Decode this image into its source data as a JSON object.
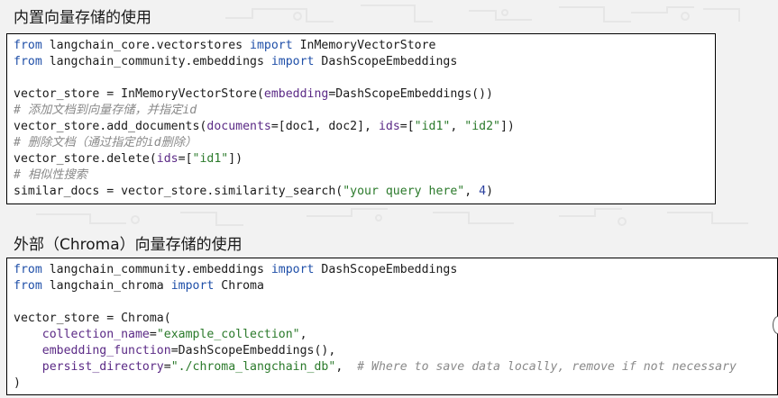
{
  "colors": {
    "keyword": "#1f4fa8",
    "parameter": "#5b2a86",
    "string": "#2b7a2b",
    "number": "#2a3f9e",
    "comment": "#8a8a8a",
    "text": "#1a1a1a"
  },
  "section1": {
    "title": "内置向量存储的使用",
    "code": {
      "l1": {
        "kw1": "from",
        "mod": " langchain_core.vectorstores ",
        "kw2": "import",
        "name": " InMemoryVectorStore"
      },
      "l2": {
        "kw1": "from",
        "mod": " langchain_community.embeddings ",
        "kw2": "import",
        "name": " DashScopeEmbeddings"
      },
      "l4": {
        "a": "vector_store = InMemoryVectorStore(",
        "p": "embedding",
        "b": "=DashScopeEmbeddings())"
      },
      "l5": {
        "comment": "# 添加文档到向量存储，并指定id"
      },
      "l6": {
        "a": "vector_store.add_documents(",
        "p1": "documents",
        "b": "=[doc1, doc2], ",
        "p2": "ids",
        "c": "=[",
        "s1": "\"id1\"",
        "d": ", ",
        "s2": "\"id2\"",
        "e": "])"
      },
      "l7": {
        "comment": "# 删除文档（通过指定的id删除）"
      },
      "l8": {
        "a": "vector_store.delete(",
        "p": "ids",
        "b": "=[",
        "s": "\"id1\"",
        "c": "])"
      },
      "l9": {
        "comment": "# 相似性搜索"
      },
      "l10": {
        "a": "similar_docs = vector_store.similarity_search(",
        "s": "\"your query here\"",
        "b": ", ",
        "n": "4",
        "c": ")"
      }
    }
  },
  "section2": {
    "title": "外部（Chroma）向量存储的使用",
    "code": {
      "l1": {
        "kw1": "from",
        "mod": " langchain_community.embeddings ",
        "kw2": "import",
        "name": " DashScopeEmbeddings"
      },
      "l2": {
        "kw1": "from",
        "mod": " langchain_chroma ",
        "kw2": "import",
        "name": " Chroma"
      },
      "l4": {
        "a": "vector_store = Chroma("
      },
      "l5": {
        "indent": "    ",
        "p": "collection_name",
        "b": "=",
        "s": "\"example_collection\"",
        "c": ","
      },
      "l6": {
        "indent": "    ",
        "p": "embedding_function",
        "b": "=DashScopeEmbeddings(),"
      },
      "l7": {
        "indent": "    ",
        "p": "persist_directory",
        "b": "=",
        "s": "\"./chroma_langchain_db\"",
        "c": ",  ",
        "comment": "# Where to save data locally, remove if not necessary"
      },
      "l8": {
        "a": ")"
      }
    }
  }
}
